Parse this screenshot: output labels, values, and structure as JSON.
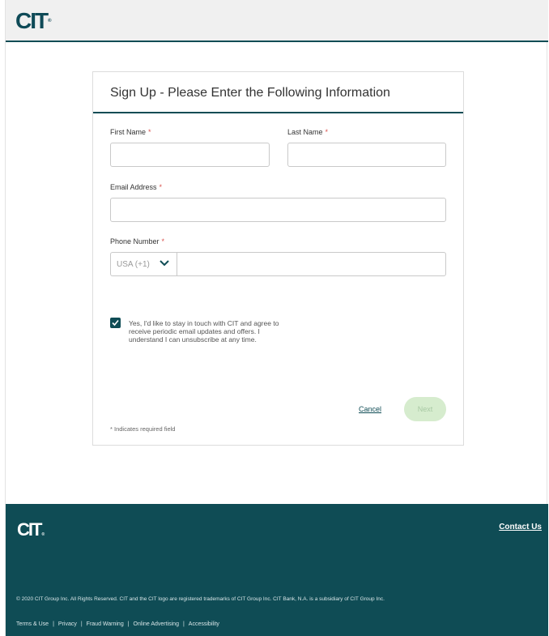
{
  "header": {
    "logo_text": "CIT",
    "logo_reg": "®"
  },
  "form": {
    "title": "Sign Up - Please Enter the Following Information",
    "first_name": {
      "label": "First Name",
      "required_mark": "*",
      "value": ""
    },
    "last_name": {
      "label": "Last Name",
      "required_mark": "*",
      "value": ""
    },
    "email": {
      "label": "Email Address",
      "required_mark": "*",
      "value": ""
    },
    "phone": {
      "label": "Phone Number",
      "required_mark": "*",
      "country_code": "USA (+1)",
      "value": ""
    },
    "consent": {
      "checked": true,
      "text": "Yes, I'd like to stay in touch with CIT and agree to receive periodic email updates and offers. I understand I can unsubscribe at any time."
    },
    "cancel_label": "Cancel",
    "next_label": "Next",
    "required_note": "* Indicates required field"
  },
  "footer": {
    "logo_text": "CIT",
    "logo_reg": "®",
    "contact_label": "Contact Us",
    "copyright": "© 2020 CIT Group Inc. All Rights Reserved. CIT and the CIT logo are registered trademarks of CIT Group Inc. CIT Bank, N.A. is a subsidiary of CIT Group Inc.",
    "links": [
      "Terms & Use",
      "Privacy",
      "Fraud Warning",
      "Online Advertising",
      "Accessibility"
    ]
  },
  "colors": {
    "brand": "#0f4c55",
    "required": "#d9534f",
    "next_disabled_bg": "#d6ecce"
  }
}
